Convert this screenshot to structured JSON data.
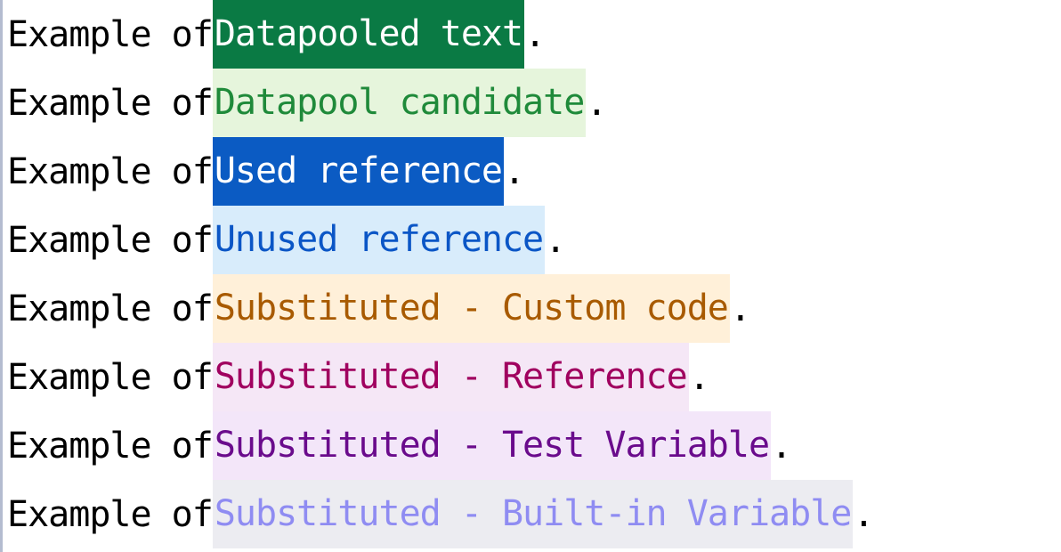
{
  "lines": [
    {
      "prefix": "Example of ",
      "term": "Datapooled text",
      "suffix": ".",
      "colors": {
        "bg": "#0a7a44",
        "fg": "#ffffff"
      }
    },
    {
      "prefix": "Example of ",
      "term": "Datapool candidate",
      "suffix": ".",
      "colors": {
        "bg": "#e6f5dc",
        "fg": "#1f8a3a"
      }
    },
    {
      "prefix": "Example of ",
      "term": "Used reference",
      "suffix": ".",
      "colors": {
        "bg": "#0b5bc3",
        "fg": "#ffffff"
      }
    },
    {
      "prefix": "Example of ",
      "term": "Unused reference",
      "suffix": ".",
      "colors": {
        "bg": "#d8ecfb",
        "fg": "#0b56c6"
      }
    },
    {
      "prefix": "Example of ",
      "term": "Substituted - Custom code",
      "suffix": ".",
      "colors": {
        "bg": "#fff0d9",
        "fg": "#a85a00"
      }
    },
    {
      "prefix": "Example of ",
      "term": "Substituted - Reference",
      "suffix": ".",
      "colors": {
        "bg": "#f5e7f6",
        "fg": "#a0005f"
      }
    },
    {
      "prefix": "Example of ",
      "term": "Substituted - Test Variable",
      "suffix": ".",
      "colors": {
        "bg": "#f3e6f9",
        "fg": "#6a0b8c"
      }
    },
    {
      "prefix": "Example of ",
      "term": "Substituted - Built-in Variable",
      "suffix": ".",
      "colors": {
        "bg": "#ececf1",
        "fg": "#8f8cf2"
      }
    }
  ]
}
